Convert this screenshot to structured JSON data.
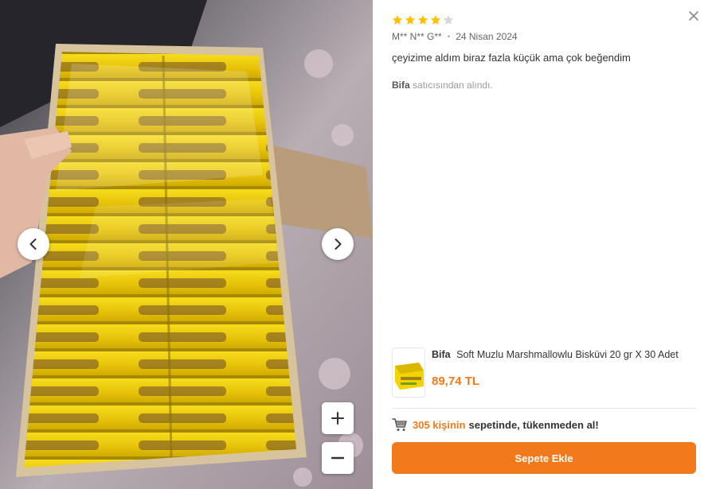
{
  "colors": {
    "accent": "#f27a1a",
    "star_filled": "#ffc000",
    "star_empty": "#d6d6d6",
    "product_yellow": "#f4d400"
  },
  "photo": {
    "subject": "box of yellow-wrapped biscuits held in hand"
  },
  "icons": {
    "prev": "chevron-left-icon",
    "next": "chevron-right-icon",
    "zoom_in": "plus-icon",
    "zoom_out": "minus-icon",
    "close": "close-icon",
    "cart": "cart-icon",
    "star": "star-icon"
  },
  "review": {
    "rating": 4,
    "rating_max": 5,
    "author": "M** N** G**",
    "date": "24 Nisan 2024",
    "text": "çeyizime aldım biraz fazla küçük ama çok beğendim",
    "seller_name": "Bifa",
    "seller_suffix": "satıcısından alındı."
  },
  "product": {
    "brand": "Bifa",
    "title": "Soft Muzlu Marshmallowlu Bisküvi 20 gr X 30 Adet",
    "price": "89,74 TL"
  },
  "basket": {
    "count_text": "305 kişinin",
    "rest_text": "sepetinde, tükenmeden al!"
  },
  "add_button_label": "Sepete Ekle"
}
